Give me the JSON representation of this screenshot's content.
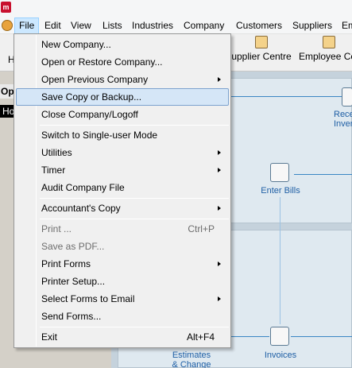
{
  "menubar": {
    "items": [
      "File",
      "Edit",
      "View",
      "Lists",
      "Industries",
      "Company",
      "Customers",
      "Suppliers",
      "Em"
    ]
  },
  "toolbar": {
    "left_partial": "H",
    "supplier_centre": "upplier Centre",
    "employee_centre": "Employee Ce"
  },
  "left_panel": {
    "header": "Ope",
    "dark_item": "Ho"
  },
  "workflow": {
    "enter_bills": "Enter Bills",
    "receive_inventory_line1": "Rece",
    "receive_inventory_line2": "Inver",
    "estimates_line1": "Estimates",
    "estimates_line2": "& Change",
    "invoices": "Invoices"
  },
  "file_menu": {
    "items": [
      {
        "label": "New Company...",
        "shortcut": "",
        "submenu": false,
        "disabled": false
      },
      {
        "label": "Open or Restore Company...",
        "shortcut": "",
        "submenu": false,
        "disabled": false
      },
      {
        "label": "Open Previous Company",
        "shortcut": "",
        "submenu": true,
        "disabled": false
      },
      {
        "label": "Save Copy or Backup...",
        "shortcut": "",
        "submenu": false,
        "disabled": false,
        "highlighted": true
      },
      {
        "label": "Close Company/Logoff",
        "shortcut": "",
        "submenu": false,
        "disabled": false
      },
      {
        "label": "Switch to Single-user Mode",
        "shortcut": "",
        "submenu": false,
        "disabled": false
      },
      {
        "label": "Utilities",
        "shortcut": "",
        "submenu": true,
        "disabled": false
      },
      {
        "label": "Timer",
        "shortcut": "",
        "submenu": true,
        "disabled": false
      },
      {
        "label": "Audit Company File",
        "shortcut": "",
        "submenu": false,
        "disabled": false
      },
      {
        "label": "Accountant's Copy",
        "shortcut": "",
        "submenu": true,
        "disabled": false
      },
      {
        "label": "Print ...",
        "shortcut": "Ctrl+P",
        "submenu": false,
        "disabled": true
      },
      {
        "label": "Save as PDF...",
        "shortcut": "",
        "submenu": false,
        "disabled": true
      },
      {
        "label": "Print Forms",
        "shortcut": "",
        "submenu": true,
        "disabled": false
      },
      {
        "label": "Printer Setup...",
        "shortcut": "",
        "submenu": false,
        "disabled": false
      },
      {
        "label": "Select Forms to Email",
        "shortcut": "",
        "submenu": true,
        "disabled": false
      },
      {
        "label": "Send Forms...",
        "shortcut": "",
        "submenu": false,
        "disabled": false
      },
      {
        "label": "Exit",
        "shortcut": "Alt+F4",
        "submenu": false,
        "disabled": false
      }
    ]
  },
  "colors": {
    "menu_highlight": "#d5e6f7",
    "menu_highlight_border": "#7da2ce",
    "flow_line": "#3a86c4",
    "workflow_label": "#1f5fa5"
  }
}
